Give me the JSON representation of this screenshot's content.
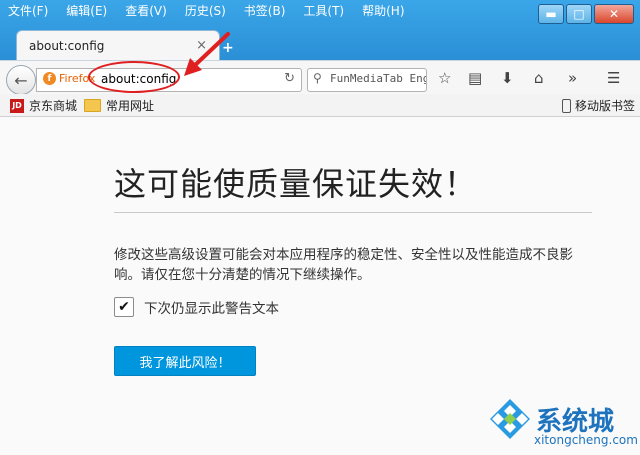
{
  "menu": [
    "文件(F)",
    "编辑(E)",
    "查看(V)",
    "历史(S)",
    "书签(B)",
    "工具(T)",
    "帮助(H)"
  ],
  "window_buttons": {
    "minimize": "▬",
    "maximize": "□",
    "close": "✕"
  },
  "tab": {
    "title": "about:config",
    "close": "×",
    "new": "+"
  },
  "nav": {
    "identity_label": "Firefox",
    "url": "about:config",
    "search_placeholder": "FunMediaTab Engi"
  },
  "bookmarks": [
    {
      "label": "京东商城",
      "icon": "jd-icon",
      "badge": "JD"
    },
    {
      "label": "常用网址",
      "icon": "folder-icon"
    }
  ],
  "mobile_bookmarks": "移动版书签",
  "content": {
    "heading": "这可能使质量保证失效！",
    "warning": "修改这些高级设置可能会对本应用程序的稳定性、安全性以及性能造成不良影响。请仅在您十分清楚的情况下继续操作。",
    "checkbox_label": "下次仍显示此警告文本",
    "checkbox_checked": true,
    "accept_button": "我了解此风险！"
  },
  "watermark": {
    "name": "系统城",
    "url": "xitongcheng.com"
  },
  "colors": {
    "accent": "#0096dd",
    "annotation": "#e02020",
    "title_bar": "#3aa6e8"
  }
}
